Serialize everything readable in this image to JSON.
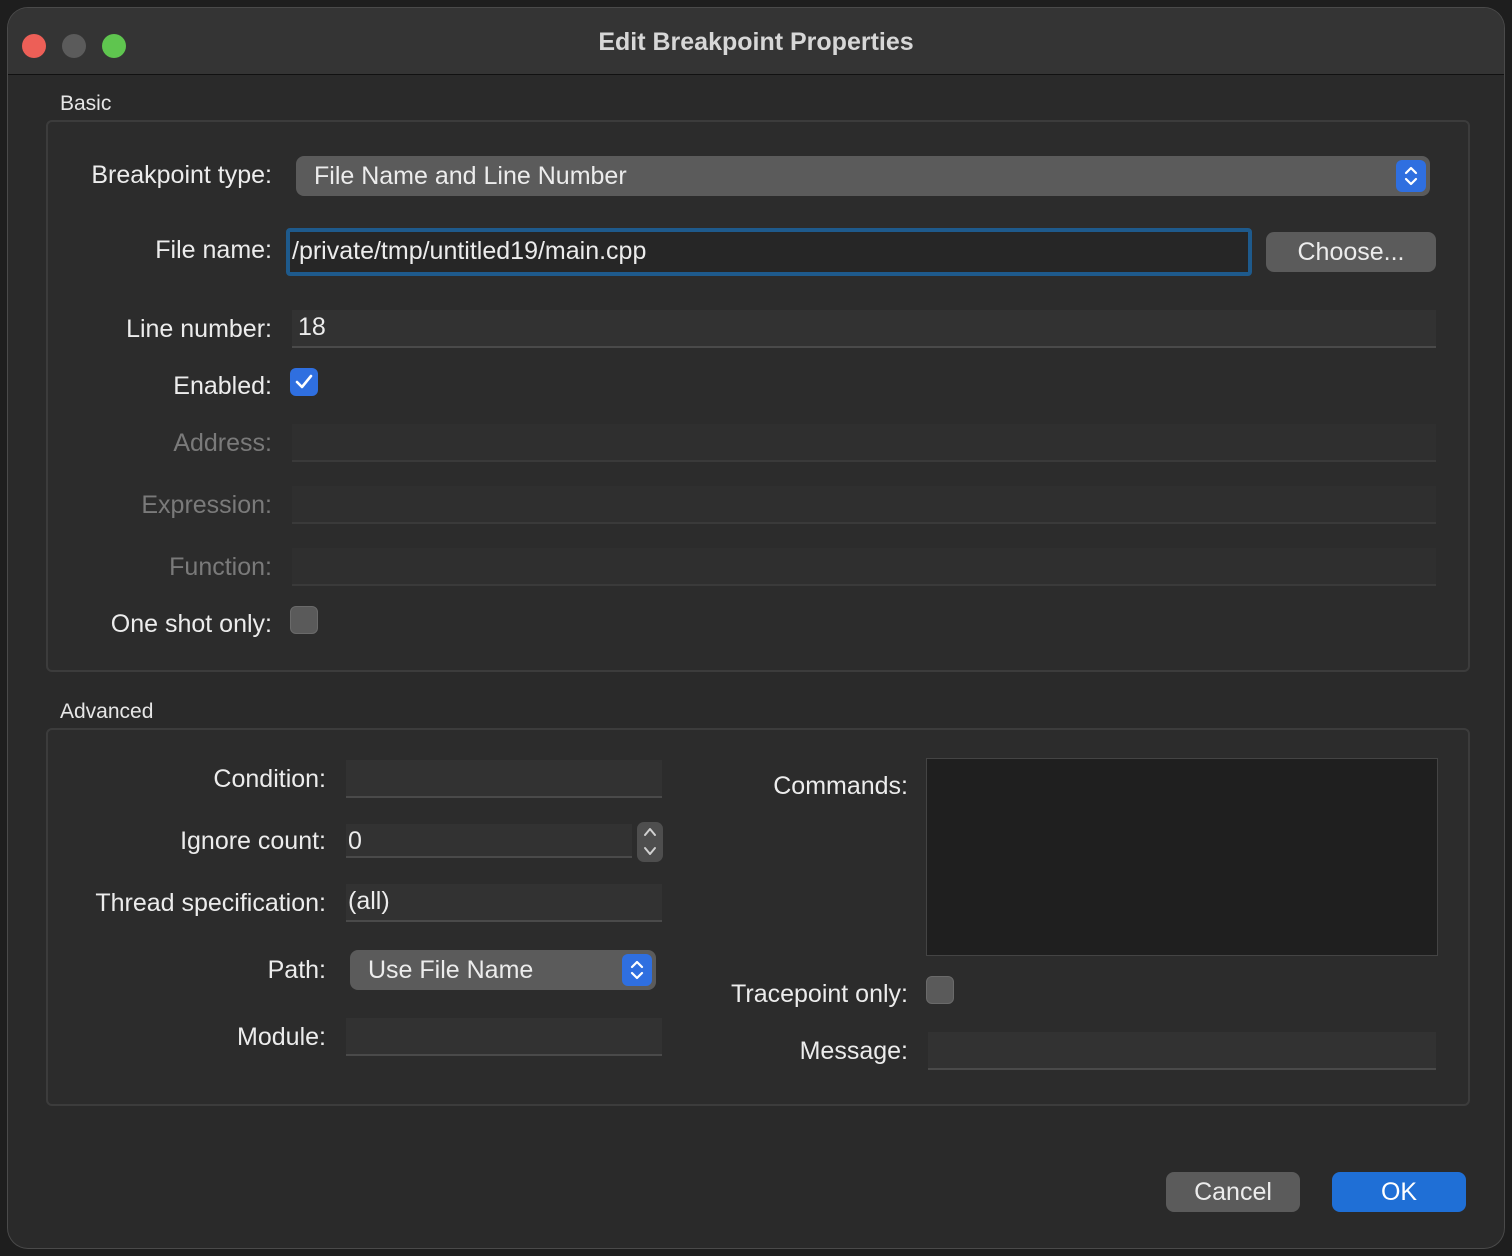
{
  "window": {
    "title": "Edit Breakpoint Properties"
  },
  "basic": {
    "group_title": "Basic",
    "breakpoint_type_label": "Breakpoint type:",
    "breakpoint_type_value": "File Name and Line Number",
    "file_name_label": "File name:",
    "file_name_value": "/private/tmp/untitled19/main.cpp",
    "choose_button": "Choose...",
    "line_number_label": "Line number:",
    "line_number_value": "18",
    "enabled_label": "Enabled:",
    "enabled_checked": true,
    "address_label": "Address:",
    "expression_label": "Expression:",
    "function_label": "Function:",
    "one_shot_label": "One shot only:",
    "one_shot_checked": false
  },
  "advanced": {
    "group_title": "Advanced",
    "condition_label": "Condition:",
    "condition_value": "",
    "ignore_count_label": "Ignore count:",
    "ignore_count_value": "0",
    "thread_spec_label": "Thread specification:",
    "thread_spec_value": "(all)",
    "path_label": "Path:",
    "path_value": "Use File Name",
    "module_label": "Module:",
    "module_value": "",
    "commands_label": "Commands:",
    "commands_value": "",
    "tracepoint_label": "Tracepoint only:",
    "tracepoint_checked": false,
    "message_label": "Message:",
    "message_value": ""
  },
  "footer": {
    "cancel_button": "Cancel",
    "ok_button": "OK"
  },
  "colors": {
    "accent": "#2f6fe0",
    "ok_button": "#1f6fd6",
    "focus_ring": "#1e5a8c",
    "close": "#ed5f57",
    "maximize": "#5fc54f"
  }
}
